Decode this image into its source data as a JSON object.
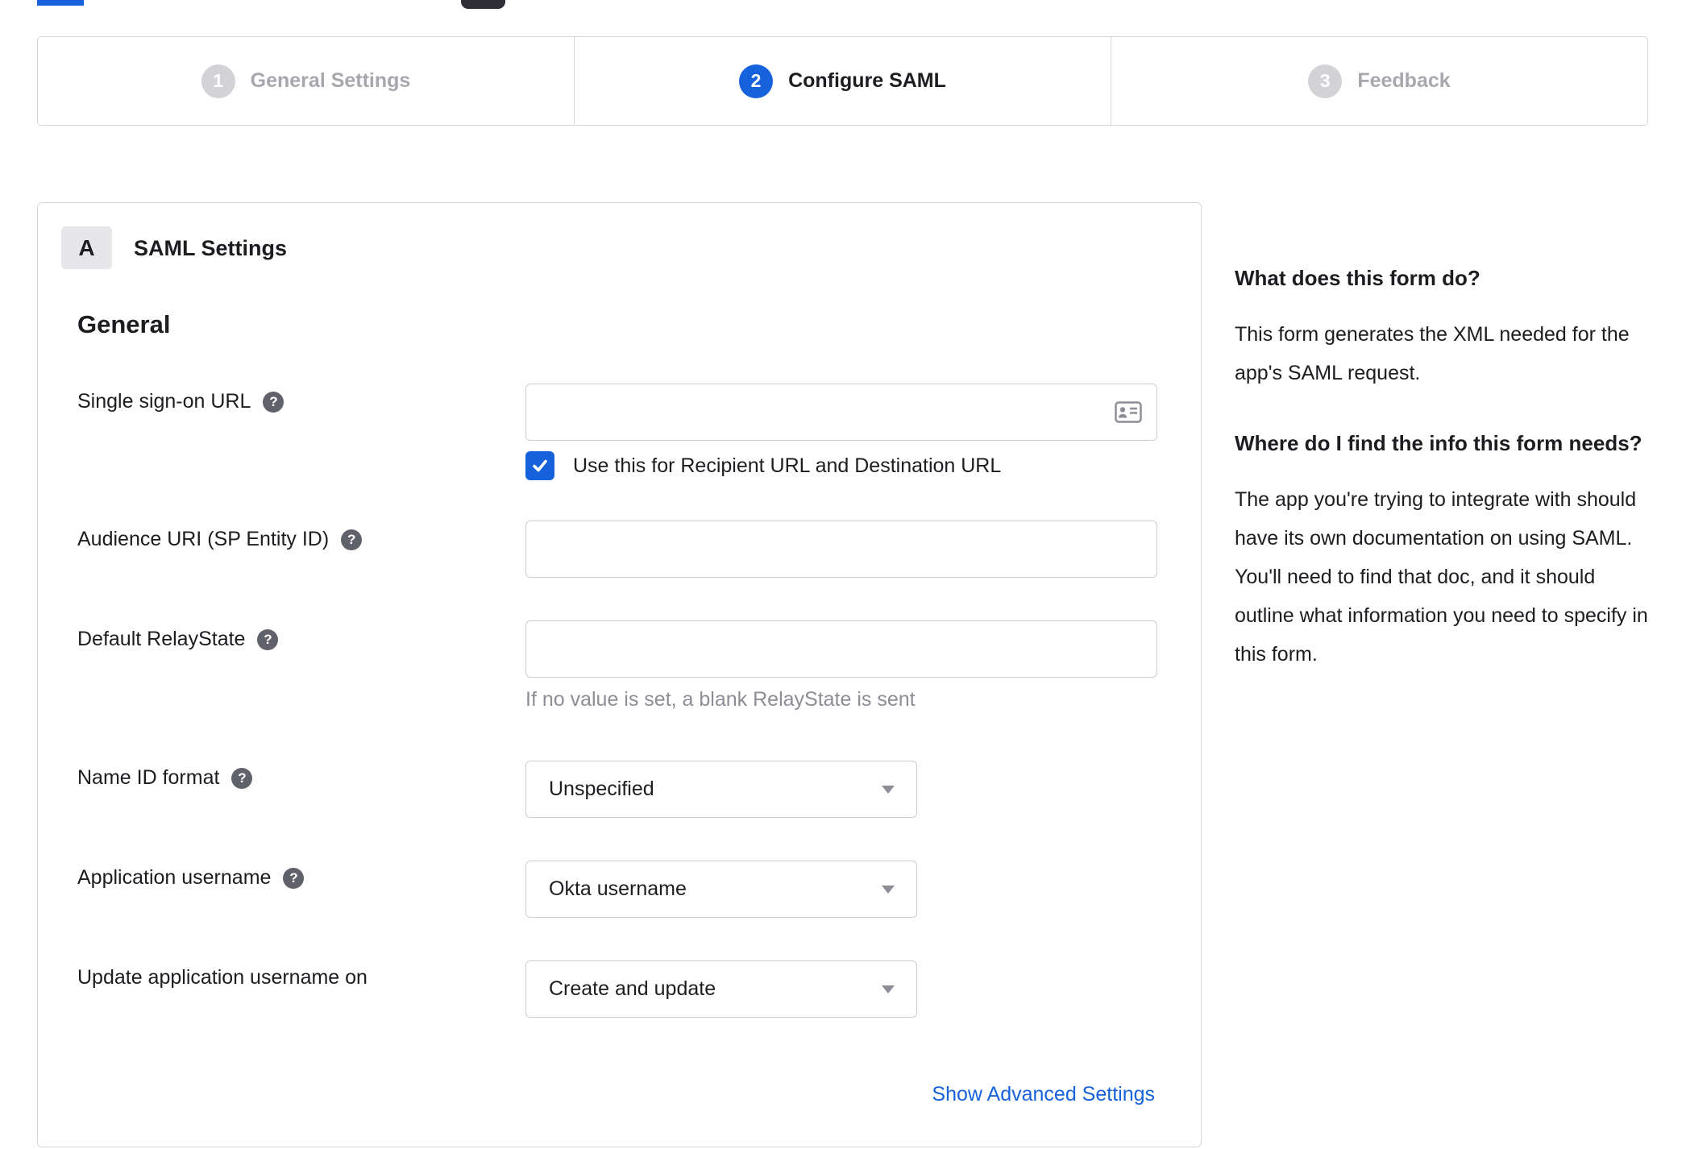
{
  "colors": {
    "primary_blue": "#1662dd",
    "border_gray": "#d8d8dc",
    "text_dark": "#1d1d21",
    "text_muted": "#8d8d95",
    "inactive_step_gray": "#d2d2d7"
  },
  "stepper": {
    "steps": [
      {
        "number": "1",
        "label": "General Settings",
        "state": "inactive"
      },
      {
        "number": "2",
        "label": "Configure SAML",
        "state": "active"
      },
      {
        "number": "3",
        "label": "Feedback",
        "state": "inactive"
      }
    ]
  },
  "saml_panel": {
    "badge": "A",
    "title": "SAML Settings",
    "section_heading": "General",
    "fields": {
      "sso_url": {
        "label": "Single sign-on URL",
        "value": "",
        "has_help": true,
        "checkbox": {
          "label": "Use this for Recipient URL and Destination URL",
          "checked": true
        }
      },
      "audience_uri": {
        "label": "Audience URI (SP Entity ID)",
        "value": "",
        "has_help": true
      },
      "relay_state": {
        "label": "Default RelayState",
        "value": "",
        "helper": "If no value is set, a blank RelayState is sent",
        "has_help": true
      },
      "name_id_format": {
        "label": "Name ID format",
        "value": "Unspecified",
        "has_help": true
      },
      "app_username": {
        "label": "Application username",
        "value": "Okta username",
        "has_help": true
      },
      "update_app_username": {
        "label": "Update application username on",
        "value": "Create and update",
        "has_help": false
      }
    },
    "advanced_link": "Show Advanced Settings"
  },
  "help_sidebar": {
    "section1": {
      "title": "What does this form do?",
      "body": "This form generates the XML needed for the app's SAML request."
    },
    "section2": {
      "title": "Where do I find the info this form needs?",
      "body": "The app you're trying to integrate with should have its own documentation on using SAML. You'll need to find that doc, and it should outline what information you need to specify in this form."
    }
  },
  "icons": {
    "help_glyph": "?"
  }
}
